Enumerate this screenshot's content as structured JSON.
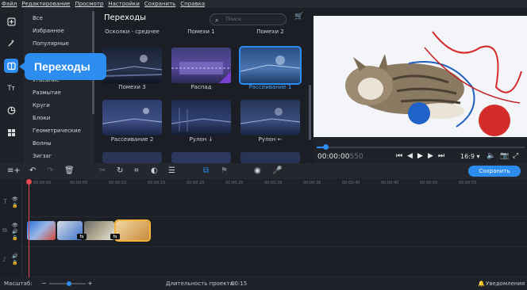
{
  "menu": [
    "Файл",
    "Редактирование",
    "Просмотр",
    "Настройки",
    "Сохранить",
    "Справка"
  ],
  "left_tools": [
    "import-icon",
    "magic-wand-icon",
    "transitions-icon",
    "text-icon",
    "stickers-icon",
    "more-tools-icon"
  ],
  "categories": [
    "Все",
    "Избранное",
    "Популярные",
    "Угасание",
    "Размытие",
    "Круги",
    "Блоки",
    "Геометрические",
    "Волны",
    "Зигзаг"
  ],
  "transitions_panel": {
    "title": "Переходы",
    "search_placeholder": "Поиск",
    "top_labels": [
      "Осколки - среднее",
      "Помехи 1",
      "Помехи 2"
    ],
    "tiles": [
      {
        "label": "Помехи 3",
        "selected": false
      },
      {
        "label": "Распад",
        "selected": false
      },
      {
        "label": "Рассеивание 1",
        "selected": true
      },
      {
        "label": "Рассеивание 2",
        "selected": false
      },
      {
        "label": "Рулон ↓",
        "selected": false
      },
      {
        "label": "Рулон ←",
        "selected": false
      }
    ]
  },
  "tooltip": "Переходы",
  "player": {
    "time": "00:00:00",
    "time_ms": "550",
    "aspect": "16:9"
  },
  "toolbar": {
    "save_label": "Сохранить"
  },
  "ruler_ticks": [
    "00:00:00",
    "00:00:05",
    "00:00:10",
    "00:00:15",
    "00:00:20",
    "00:00:25",
    "00:00:30",
    "00:00:35",
    "00:00:40",
    "00:00:45",
    "00:00:50",
    "00:00:55"
  ],
  "statusbar": {
    "scale_label": "Масштаб:",
    "duration_label": "Длительность проекта:",
    "duration_value": "00:15",
    "notifications": "Уведомления"
  },
  "colors": {
    "accent": "#2d8cf0",
    "playhead": "#e5484d",
    "clip_selected_border": "#f5b53d"
  }
}
